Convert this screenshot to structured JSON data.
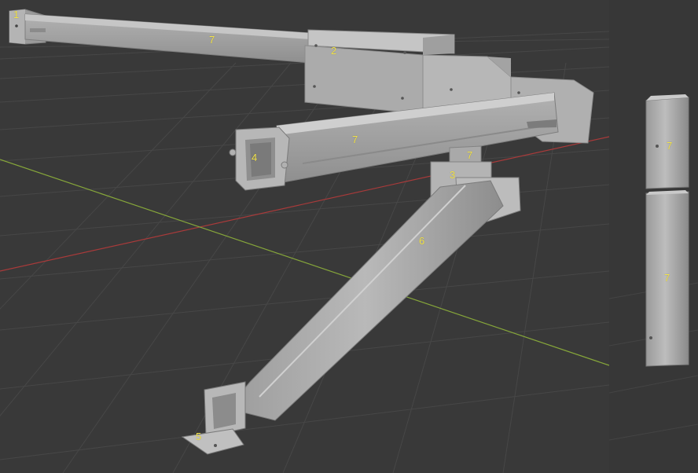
{
  "viewport": {
    "background": "#393939",
    "grid_color": "#4a4a4a",
    "x_axis_color": "#a83a3a",
    "y_axis_color": "#86a63a",
    "model_color": "#a9a9a9"
  },
  "labels": {
    "l1": "1",
    "l2": "2",
    "l3": "3",
    "l4": "4",
    "l5": "5",
    "l6": "6",
    "l7a": "7",
    "l7b": "7",
    "l7c": "7",
    "l7d": "7",
    "l7e": "7"
  }
}
